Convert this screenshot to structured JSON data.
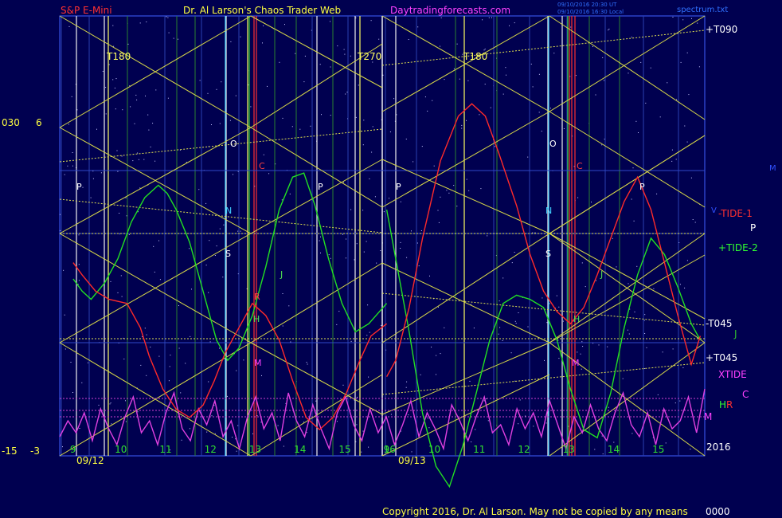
{
  "header": {
    "instrument": "S&P E-Mini",
    "author": "Dr. Al Larson's Chaos Trader Web",
    "website": "Daytradingforecasts.com",
    "timestamp_1": "09/10/2016 20:30 UT",
    "timestamp_2": "09/10/2016 16:30 Local",
    "file": "spectrum.txt"
  },
  "footer": {
    "copyright": "Copyright 2016, Dr. Al Larson. May not be copied by any means",
    "tail": "0000"
  },
  "left_axis": {
    "scale_top": "030",
    "top_value": "6",
    "bottom_scale": "-15",
    "bottom_value": "-3"
  },
  "right_labels": {
    "t090_plus": "+T090",
    "tide1": "-TIDE-1",
    "p": "P",
    "tide2": "+TIDE-2",
    "t045_minus": "-T045",
    "j": "J",
    "t045_plus": "+T045",
    "xtide": "XTIDE",
    "c": "C",
    "h": "H",
    "r": "R",
    "m": "M",
    "year": "2016",
    "v": "V",
    "m_edge": "M"
  },
  "chart_data": {
    "type": "line",
    "title": "S&P E-Mini",
    "days": [
      "09/12",
      "09/13"
    ],
    "x_hours": [
      9,
      10,
      11,
      12,
      13,
      14,
      15,
      16
    ],
    "y_range": [
      -3,
      6
    ],
    "transit_labels": [
      "T180",
      "T270",
      "T180"
    ],
    "planet_markers": [
      "P",
      "O",
      "C",
      "N",
      "S",
      "J",
      "R",
      "H",
      "M",
      "V"
    ],
    "series": [
      {
        "name": "TIDE-1",
        "color": "#ff2a2a",
        "x": [
          9.0,
          9.2,
          9.5,
          9.8,
          10.2,
          10.5,
          10.7,
          11.0,
          11.3,
          11.6,
          11.9,
          12.15,
          12.4,
          12.7,
          13.0,
          13.3,
          13.6,
          13.9,
          14.2,
          14.5,
          14.8,
          15.1,
          15.4,
          15.65,
          16.0,
          16.0,
          16.2,
          16.5,
          16.8,
          17.2,
          17.6,
          17.9,
          18.2,
          18.5,
          18.9,
          19.2,
          19.5,
          19.8,
          20.1,
          20.4,
          20.7,
          21.0,
          21.3,
          21.6,
          21.9,
          22.2,
          22.5,
          22.8,
          23.0
        ],
        "y": [
          1.9,
          1.6,
          1.2,
          1.0,
          0.9,
          0.3,
          -0.4,
          -1.2,
          -1.7,
          -1.9,
          -1.6,
          -1.0,
          -0.3,
          0.3,
          0.9,
          0.6,
          0.0,
          -1.0,
          -1.9,
          -2.2,
          -1.9,
          -1.3,
          -0.5,
          0.1,
          0.4,
          -0.9,
          -0.5,
          0.8,
          2.5,
          4.4,
          5.5,
          5.8,
          5.5,
          4.6,
          3.3,
          2.1,
          1.2,
          0.7,
          0.4,
          0.8,
          1.6,
          2.5,
          3.4,
          4.0,
          3.2,
          1.9,
          0.6,
          -0.6,
          0.1
        ]
      },
      {
        "name": "TIDE-2",
        "color": "#22e022",
        "x": [
          9.0,
          9.2,
          9.4,
          9.7,
          10.0,
          10.3,
          10.6,
          10.9,
          11.1,
          11.3,
          11.6,
          11.9,
          12.2,
          12.45,
          12.7,
          13.0,
          13.3,
          13.6,
          13.9,
          14.15,
          14.4,
          14.7,
          15.0,
          15.3,
          15.6,
          16.0,
          16.0,
          16.2,
          16.5,
          16.8,
          17.1,
          17.4,
          17.7,
          18.0,
          18.3,
          18.6,
          18.9,
          19.2,
          19.5,
          19.8,
          20.1,
          20.4,
          20.7,
          21.0,
          21.3,
          21.6,
          21.9,
          22.2,
          22.5,
          22.8,
          23.0
        ],
        "y": [
          1.5,
          1.2,
          1.0,
          1.4,
          2.0,
          2.9,
          3.5,
          3.8,
          3.6,
          3.2,
          2.4,
          1.2,
          0.0,
          -0.5,
          -0.2,
          0.6,
          1.8,
          3.2,
          4.0,
          4.1,
          3.3,
          2.0,
          0.9,
          0.2,
          0.4,
          0.9,
          3.2,
          2.0,
          0.2,
          -1.8,
          -3.1,
          -3.6,
          -2.6,
          -1.3,
          0.0,
          0.9,
          1.1,
          1.0,
          0.8,
          0.0,
          -1.2,
          -2.2,
          -2.4,
          -1.3,
          0.3,
          1.6,
          2.5,
          2.1,
          1.3,
          0.4,
          0.0
        ]
      },
      {
        "name": "XTIDE",
        "color": "#e040e0",
        "y_range": [
          -3,
          -1.2
        ],
        "values": [
          -2.6,
          -2.2,
          -2.5,
          -2.0,
          -2.7,
          -1.9,
          -2.4,
          -2.8,
          -2.1,
          -1.6,
          -2.5,
          -2.2,
          -2.8,
          -2.0,
          -1.5,
          -2.4,
          -2.7,
          -1.9,
          -2.3,
          -1.7,
          -2.6,
          -2.2,
          -2.9,
          -2.1,
          -1.6,
          -2.4,
          -2.0,
          -2.7,
          -1.5,
          -2.2,
          -2.6,
          -1.8,
          -2.4,
          -2.9,
          -2.0,
          -1.6,
          -2.3,
          -2.7,
          -1.9,
          -2.5,
          -2.1,
          -2.8,
          -2.3,
          -1.7,
          -2.6,
          -2.0,
          -2.4,
          -2.9,
          -1.8,
          -2.2,
          -2.7,
          -2.1,
          -1.6,
          -2.5,
          -2.3,
          -2.8,
          -1.9,
          -2.4,
          -2.0,
          -2.6,
          -1.7,
          -2.3,
          -2.9,
          -2.1,
          -2.5,
          -1.8,
          -2.4,
          -2.7,
          -2.0,
          -1.5,
          -2.3,
          -2.6,
          -2.0,
          -2.8,
          -1.9,
          -2.4,
          -2.2,
          -1.6,
          -2.5,
          -1.4
        ]
      }
    ]
  },
  "colors": {
    "background": "#000050",
    "plot_border": "#4060ff",
    "grid_yellow": "#e0e050",
    "tide1": "#ff2a2a",
    "tide2": "#22e022",
    "xtide": "#e040e0"
  }
}
